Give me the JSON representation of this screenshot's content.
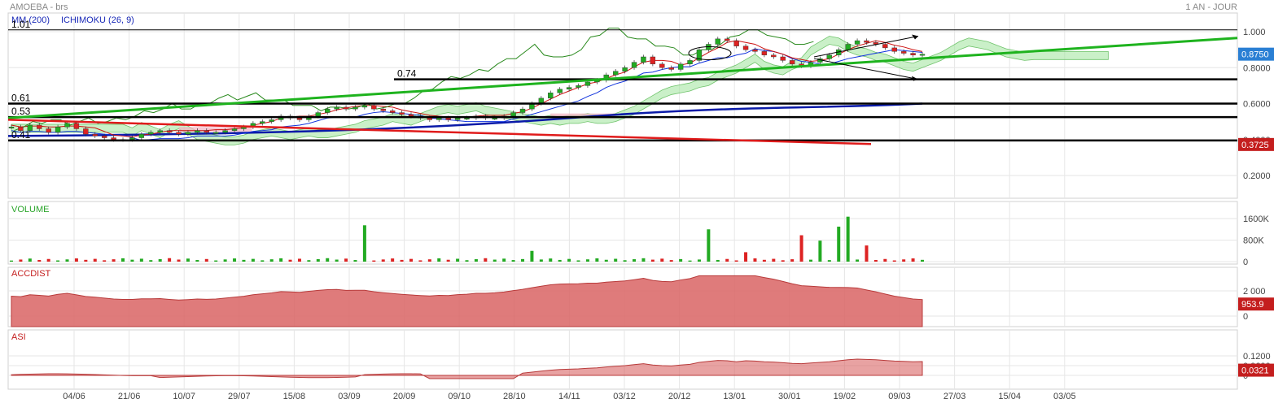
{
  "header": {
    "title": "AMOEBA - brs",
    "period": "1 AN - JOUR"
  },
  "colors": {
    "grid": "#e6e6e6",
    "frame": "#d0d0d0",
    "bull": "#22aa22",
    "bear": "#dd2222",
    "ma200": "#0a1aa8",
    "tenkan": "#cc1111",
    "kijun": "#1133dd",
    "chikou": "#2a8a1e",
    "cloud_bull": "#9ee39a",
    "cloud_bear": "#f4b0c0",
    "trend_green": "#1eb31e",
    "trend_red": "#e01b1b",
    "accdist": "#d96464",
    "price_badge": "#2a7fd4",
    "neg_badge": "#c41e1e"
  },
  "chart_data": {
    "type": "candlestick",
    "x_ticks": [
      "04/06",
      "21/06",
      "10/07",
      "29/07",
      "15/08",
      "03/09",
      "20/09",
      "09/10",
      "28/10",
      "14/11",
      "03/12",
      "20/12",
      "13/01",
      "30/01",
      "19/02",
      "09/03",
      "27/03",
      "15/04",
      "03/05"
    ],
    "price_panel": {
      "indicators_label": {
        "ma": "MM (200)",
        "ichimoku": "ICHIMOKU (26, 9)"
      },
      "yticks": [
        "1.000",
        "0.8000",
        "0.6000",
        "0.4000",
        "0.2000"
      ],
      "ylim": [
        0.0,
        1.1
      ],
      "last_price": "0.8750",
      "low_marker": "0.3725",
      "levels": [
        {
          "label": "1.01",
          "value": 1.01
        },
        {
          "label": "0.74",
          "value": 0.735
        },
        {
          "label": "0.61",
          "value": 0.6
        },
        {
          "label": "0.53",
          "value": 0.525
        },
        {
          "label": "0.41",
          "value": 0.395
        }
      ],
      "close_series": [
        0.47,
        0.45,
        0.48,
        0.46,
        0.44,
        0.47,
        0.49,
        0.46,
        0.43,
        0.42,
        0.41,
        0.4,
        0.4,
        0.41,
        0.43,
        0.44,
        0.45,
        0.44,
        0.43,
        0.44,
        0.45,
        0.44,
        0.44,
        0.45,
        0.46,
        0.47,
        0.49,
        0.5,
        0.51,
        0.53,
        0.52,
        0.51,
        0.53,
        0.55,
        0.57,
        0.58,
        0.57,
        0.58,
        0.59,
        0.57,
        0.56,
        0.55,
        0.54,
        0.53,
        0.52,
        0.51,
        0.52,
        0.51,
        0.52,
        0.52,
        0.53,
        0.52,
        0.52,
        0.53,
        0.55,
        0.57,
        0.6,
        0.63,
        0.66,
        0.68,
        0.69,
        0.7,
        0.72,
        0.73,
        0.76,
        0.78,
        0.8,
        0.83,
        0.86,
        0.82,
        0.8,
        0.79,
        0.82,
        0.84,
        0.9,
        0.93,
        0.96,
        0.95,
        0.92,
        0.9,
        0.89,
        0.87,
        0.86,
        0.84,
        0.82,
        0.81,
        0.83,
        0.85,
        0.87,
        0.9,
        0.93,
        0.95,
        0.94,
        0.93,
        0.91,
        0.89,
        0.88,
        0.87,
        0.875
      ]
    },
    "volume_panel": {
      "label": "VOLUME",
      "yticks": [
        "1600K",
        "800K",
        "0"
      ]
    },
    "accdist_panel": {
      "label": "ACCDIST",
      "yticks": [
        "2 000",
        "0"
      ],
      "last_value": "953.9"
    },
    "asi_panel": {
      "label": "ASI",
      "yticks": [
        "0.1200",
        "0.0600",
        "0"
      ],
      "last_value": "0.0321"
    }
  }
}
